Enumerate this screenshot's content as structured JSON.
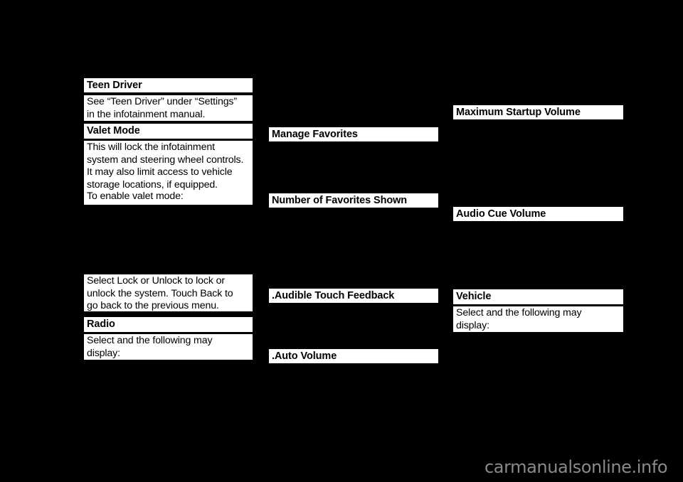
{
  "page": {
    "background_color": "#000000",
    "text_block_color": "#ffffff",
    "text_color": "#000000"
  },
  "columns": [
    {
      "name": "column-1",
      "blocks": [
        {
          "id": "c1-teen-driver-head",
          "name": "teen-driver-heading",
          "style": "head",
          "text": "Teen Driver"
        },
        {
          "id": "c1-teen-driver-body",
          "name": "teen-driver-body",
          "style": "body",
          "text": "See “Teen Driver” under “Settings”\nin the infotainment manual."
        },
        {
          "id": "c1-valet-mode-head",
          "name": "valet-mode-heading",
          "style": "head",
          "text": "Valet Mode"
        },
        {
          "id": "c1-valet-mode-body",
          "name": "valet-mode-body",
          "style": "body",
          "text": "This will lock the infotainment\nsystem and steering wheel controls.\nIt may also limit access to vehicle\nstorage locations, if equipped."
        },
        {
          "id": "c1-enable-valet",
          "name": "enable-valet-mode-text",
          "style": "body",
          "text": "To enable valet mode:"
        },
        {
          "id": "c1-lock-unlock",
          "name": "lock-unlock-body",
          "style": "body",
          "text": "Select Lock or Unlock to lock or\nunlock the system. Touch Back to\ngo back to the previous menu."
        },
        {
          "id": "c1-radio-head",
          "name": "radio-heading",
          "style": "head",
          "text": "Radio"
        },
        {
          "id": "c1-radio-body",
          "name": "radio-body",
          "style": "body",
          "text": "Select and the following may\ndisplay:"
        }
      ]
    },
    {
      "name": "column-2",
      "blocks": [
        {
          "id": "c2-manage-favorites",
          "name": "manage-favorites-heading",
          "style": "head",
          "text": "Manage Favorites"
        },
        {
          "id": "c2-number-favorites",
          "name": "number-of-favorites-shown-heading",
          "style": "head",
          "text": "Number of Favorites Shown"
        },
        {
          "id": "c2-audible-touch",
          "name": "audible-touch-feedback-heading",
          "style": "head",
          "text": ".Audible Touch Feedback"
        },
        {
          "id": "c2-auto-volume",
          "name": "auto-volume-heading",
          "style": "head",
          "text": ".Auto Volume"
        }
      ]
    },
    {
      "name": "column-3",
      "blocks": [
        {
          "id": "c3-max-startup-volume",
          "name": "maximum-startup-volume-heading",
          "style": "head",
          "text": "Maximum Startup Volume"
        },
        {
          "id": "c3-audio-cue-volume",
          "name": "audio-cue-volume-heading",
          "style": "head",
          "text": "Audio Cue Volume"
        },
        {
          "id": "c3-vehicle-head",
          "name": "vehicle-heading",
          "style": "head",
          "text": "Vehicle"
        },
        {
          "id": "c3-vehicle-body",
          "name": "vehicle-body",
          "style": "body",
          "text": "Select and the following may\ndisplay:"
        }
      ]
    }
  ],
  "watermark": {
    "text": "carmanualsonline.info",
    "color": "#8a8a8a"
  }
}
